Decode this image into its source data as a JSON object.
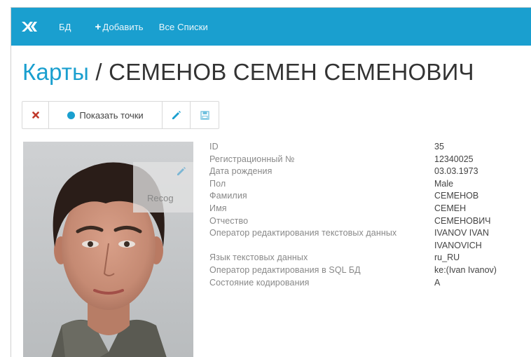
{
  "colors": {
    "brand": "#1a9fcf",
    "navbar": "#1a9fcf",
    "title_link": "#1a9fcf",
    "close_icon": "#c0392b"
  },
  "navbar": {
    "logo_icon": "app-logo-icon",
    "items": [
      {
        "label": "БД"
      },
      {
        "label": "Добавить",
        "prefix": "+"
      },
      {
        "label": "Все Списки"
      }
    ]
  },
  "title": {
    "link": "Карты",
    "separator": " / ",
    "name": "СЕМЕНОВ СЕМЕН СЕМЕНОВИЧ"
  },
  "toolbar": {
    "close_icon": "close-icon",
    "show_points_label": "Показать точки",
    "edit_icon": "pencil-icon",
    "save_icon": "save-icon"
  },
  "photo": {
    "overlay_label": "Recog"
  },
  "details": {
    "rows": [
      {
        "label": "ID",
        "value": "35"
      },
      {
        "label": "Регистрационный №",
        "value": "12340025"
      },
      {
        "label": "Дата рождения",
        "value": "03.03.1973"
      },
      {
        "label": "Пол",
        "value": "Male"
      },
      {
        "label": "Фамилия",
        "value": "СЕМЕНОВ"
      },
      {
        "label": "Имя",
        "value": "СЕМЕН"
      },
      {
        "label": "Отчество",
        "value": "СЕМЕНОВИЧ"
      },
      {
        "label": "Оператор редактирования текстовых данных",
        "value": "IVANOV IVAN IVANOVICH"
      },
      {
        "label": "Язык текстовых данных",
        "value": "ru_RU"
      },
      {
        "label": "Оператор редактирования в SQL БД",
        "value": "ke:(Ivan Ivanov)"
      },
      {
        "label": "Состояние кодирования",
        "value": "A"
      }
    ]
  }
}
